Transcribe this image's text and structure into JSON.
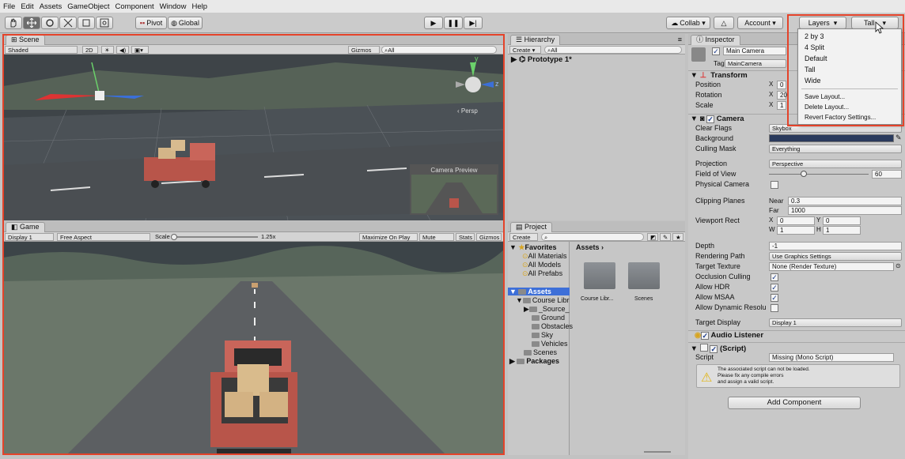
{
  "menu": [
    "File",
    "Edit",
    "Assets",
    "GameObject",
    "Component",
    "Window",
    "Help"
  ],
  "toolbar": {
    "pivot": "Pivot",
    "global": "Global",
    "collab": "Collab",
    "account": "Account",
    "layers": "Layers",
    "layout": "Tall"
  },
  "scene": {
    "tab": "Scene",
    "shading": "Shaded",
    "mode2d": "2D",
    "gizmos": "Gizmos",
    "search": "All",
    "persp": "‹ Persp",
    "axis_y": "y",
    "axis_z": "z",
    "camera_preview": "Camera Preview"
  },
  "game": {
    "tab": "Game",
    "display": "Display 1",
    "aspect": "Free Aspect",
    "scale_label": "Scale",
    "scale_value": "1.25x",
    "maximize": "Maximize On Play",
    "mute": "Mute Audio",
    "stats": "Stats",
    "gizmos": "Gizmos"
  },
  "hierarchy": {
    "tab": "Hierarchy",
    "create": "Create",
    "search": "All",
    "scene_item": "Prototype 1*"
  },
  "project": {
    "tab": "Project",
    "create": "Create",
    "favorites_label": "Favorites",
    "favorites": [
      "All Materials",
      "All Models",
      "All Prefabs"
    ],
    "assets_label": "Assets",
    "assets_tree": [
      "Course Libr",
      "_Source_",
      "Ground",
      "Obstacles",
      "Sky",
      "Vehicles",
      "Scenes"
    ],
    "packages": "Packages",
    "breadcrumb": "Assets",
    "grid_items": [
      "Course Libr...",
      "Scenes"
    ]
  },
  "inspector": {
    "tab": "Inspector",
    "object_name": "Main Camera",
    "tag_label": "Tag",
    "tag_value": "MainCamera",
    "transform": {
      "title": "Transform",
      "position": "Position",
      "rotation": "Rotation",
      "scale": "Scale",
      "pos_x": "0",
      "rot_x": "20",
      "scale_x": "1"
    },
    "camera": {
      "title": "Camera",
      "rows": [
        {
          "label": "Clear Flags",
          "value": "Skybox"
        },
        {
          "label": "Background",
          "value": ""
        },
        {
          "label": "Culling Mask",
          "value": "Everything"
        },
        {
          "label": "Projection",
          "value": "Perspective"
        },
        {
          "label": "Field of View",
          "value": "60"
        },
        {
          "label": "Physical Camera",
          "value": ""
        },
        {
          "label": "Clipping Planes",
          "near_label": "Near",
          "near": "0.3",
          "far_label": "Far",
          "far": "1000"
        },
        {
          "label": "Viewport Rect",
          "x": "0",
          "y": "0",
          "w": "1",
          "h": "1"
        },
        {
          "label": "Depth",
          "value": "-1"
        },
        {
          "label": "Rendering Path",
          "value": "Use Graphics Settings"
        },
        {
          "label": "Target Texture",
          "value": "None (Render Texture)"
        },
        {
          "label": "Occlusion Culling",
          "value": ""
        },
        {
          "label": "Allow HDR",
          "value": ""
        },
        {
          "label": "Allow MSAA",
          "value": ""
        },
        {
          "label": "Allow Dynamic Resolu",
          "value": ""
        },
        {
          "label": "Target Display",
          "value": "Display 1"
        }
      ]
    },
    "audio_listener": "Audio Listener",
    "script": {
      "title": "(Script)",
      "label": "Script",
      "value": "Missing (Mono Script)",
      "warning": [
        "The associated script can not be loaded.",
        "Please fix any compile errors",
        "and assign a valid script."
      ]
    },
    "add_component": "Add Component"
  },
  "layout_menu": {
    "items": [
      "2 by 3",
      "4 Split",
      "Default",
      "Tall",
      "Wide"
    ],
    "actions": [
      "Save Layout...",
      "Delete Layout...",
      "Revert Factory Settings..."
    ]
  },
  "colors": {
    "highlight": "#e4432a",
    "selection": "#3d6fd8",
    "background_swatch": "#2a3a5c"
  }
}
